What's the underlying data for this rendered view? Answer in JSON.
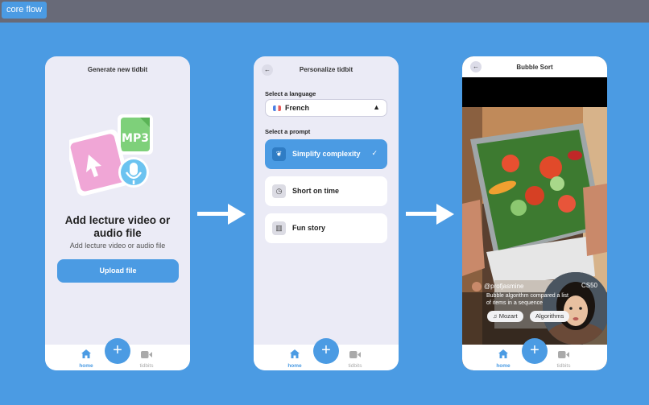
{
  "flow_tag": "core flow",
  "screen1": {
    "title": "Generate new tidbit",
    "heading": "Add lecture video or audio file",
    "subheading": "Add lecture video or audio file",
    "upload_button": "Upload file",
    "illustration_text": "MP3"
  },
  "screen2": {
    "title": "Personalize tidbit",
    "language_label": "Select a language",
    "language_value": "French",
    "prompt_label": "Select a prompt",
    "prompts": [
      {
        "label": "Simplify complexity",
        "selected": true,
        "icon": "leaf-icon"
      },
      {
        "label": "Short on time",
        "selected": false,
        "icon": "clock-icon"
      },
      {
        "label": "Fun story",
        "selected": false,
        "icon": "book-icon"
      }
    ]
  },
  "screen3": {
    "title": "Bubble Sort",
    "creator": "@profjasmine",
    "series": "CS50",
    "caption": "Bubble algorithm compared a list of items in a sequence",
    "chips": [
      "♫ Mozart",
      "Algorithms"
    ]
  },
  "nav": {
    "home": "home",
    "tidbits": "tidbits",
    "fab": "+"
  },
  "colors": {
    "accent": "#4b9be3",
    "canvas": "#4b9be3",
    "topbar": "#686a78",
    "phone_bg": "#ebebf6"
  }
}
